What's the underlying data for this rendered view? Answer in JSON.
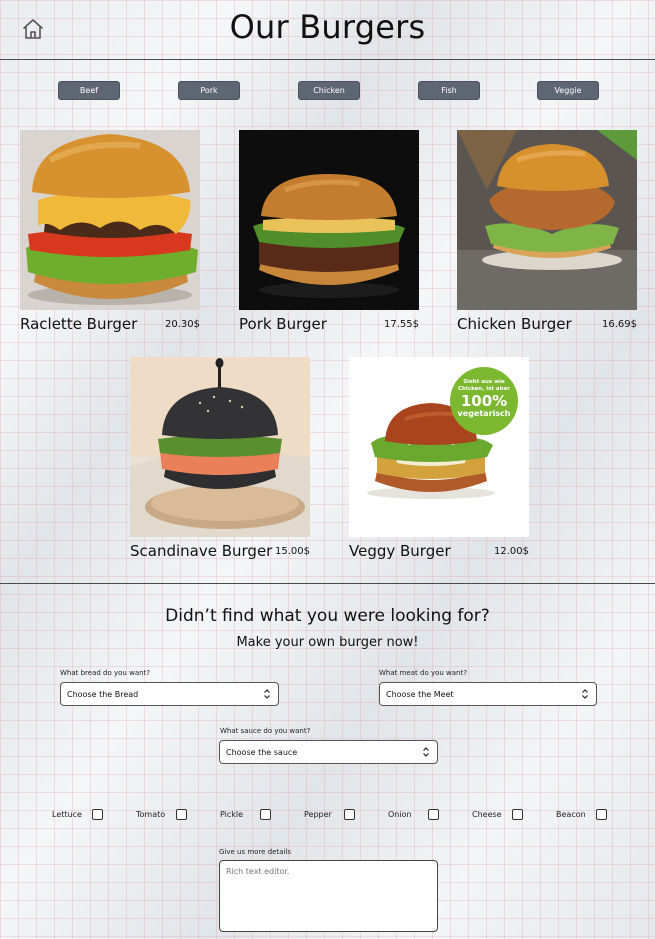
{
  "header": {
    "title": "Our Burgers",
    "home_icon": "home-icon"
  },
  "categories": [
    "Beef",
    "Pork",
    "Chicken",
    "Fish",
    "Veggie"
  ],
  "products": [
    {
      "name": "Raclette Burger",
      "price": "20.30$"
    },
    {
      "name": "Pork Burger",
      "price": "17.55$"
    },
    {
      "name": "Chicken Burger",
      "price": "16.69$"
    },
    {
      "name": "Scandinave Burger",
      "price": "15.00$"
    },
    {
      "name": "Veggy Burger",
      "price": "12.00$"
    }
  ],
  "veggy_badge": {
    "line1": "Sieht aus wie",
    "line2": "Chicken, ist aber",
    "line3": "100%",
    "line4": "vegetarisch",
    "color": "#7cb82f"
  },
  "custom": {
    "title": "Didn’t find what you were looking for?",
    "subtitle": "Make your own burger now!",
    "bread": {
      "label": "What bread do you want?",
      "value": "Choose the Bread"
    },
    "meat": {
      "label": "What meat do you want?",
      "value": "Choose the Meet"
    },
    "sauce": {
      "label": "What sauce do you want?",
      "value": "Choose the sauce"
    },
    "toppings": [
      "Lettuce",
      "Tomato",
      "Pickle",
      "Pepper",
      "Onion",
      "Cheese",
      "Beacon"
    ],
    "details": {
      "label": "Give us more details",
      "placeholder": "Rich text editor."
    }
  },
  "colors": {
    "button_bg": "#5e6674",
    "divider": "#4a4a4a",
    "grid": "#e196a0"
  }
}
